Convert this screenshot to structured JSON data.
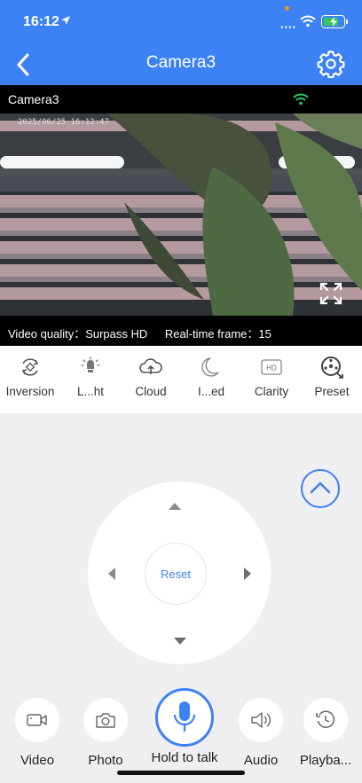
{
  "status_bar": {
    "time": "16:12"
  },
  "header": {
    "title": "Camera3"
  },
  "video": {
    "camera_name": "Camera3",
    "timestamp": "2025/06/25 16:12:47",
    "quality_text": "Video quality：Surpass HD",
    "frame_text": "Real-time frame：15"
  },
  "toolbar": {
    "items": [
      {
        "label": "Inversion",
        "icon": "inversion-icon"
      },
      {
        "label": "L...ht",
        "icon": "light-icon"
      },
      {
        "label": "Cloud",
        "icon": "cloud-icon"
      },
      {
        "label": "I...ed",
        "icon": "moon-icon"
      },
      {
        "label": "Clarity",
        "icon": "hd-icon",
        "badge": "HD"
      },
      {
        "label": "Preset",
        "icon": "preset-icon"
      }
    ]
  },
  "ptz": {
    "reset_label": "Reset"
  },
  "actions": {
    "video": "Video",
    "photo": "Photo",
    "talk": "Hold to talk",
    "audio": "Audio",
    "playback": "Playba..."
  },
  "colors": {
    "accent": "#3c82f4",
    "wifi_green": "#34c759",
    "background": "#efeff1"
  }
}
